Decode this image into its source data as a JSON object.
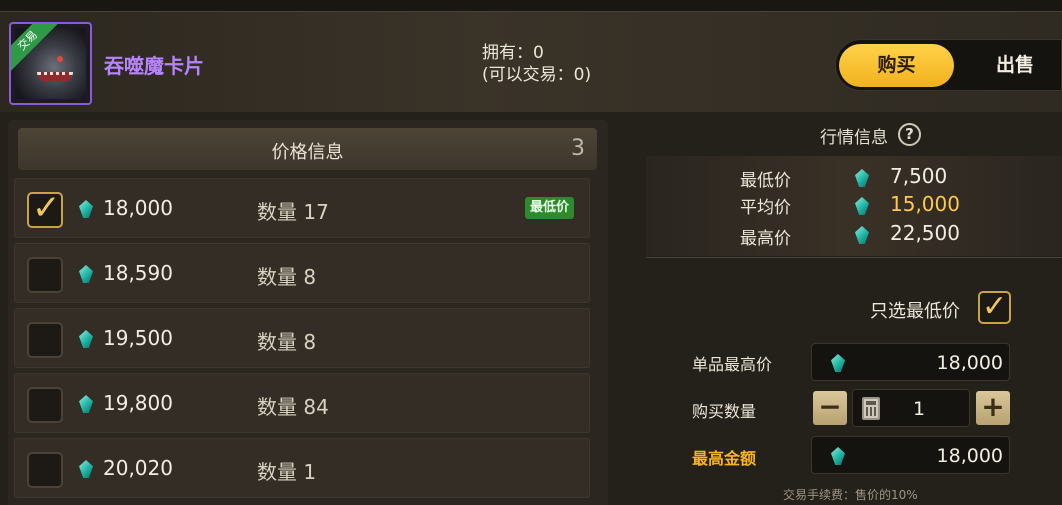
{
  "item": {
    "name": "吞噬魔卡片",
    "trade_ribbon": "交易",
    "owned_line1": "拥有：0",
    "owned_line2": "(可以交易：0)"
  },
  "toggle": {
    "buy_label": "购买",
    "sell_label": "出售"
  },
  "price_panel": {
    "title": "价格信息",
    "count": "3",
    "rows": [
      {
        "price": "18,000",
        "qty": "数量 17",
        "checked": true,
        "badge": "最低价"
      },
      {
        "price": "18,590",
        "qty": "数量 8",
        "checked": false
      },
      {
        "price": "19,500",
        "qty": "数量 8",
        "checked": false
      },
      {
        "price": "19,800",
        "qty": "数量 84",
        "checked": false
      },
      {
        "price": "20,020",
        "qty": "数量 1",
        "checked": false
      }
    ]
  },
  "market": {
    "title": "行情信息",
    "help_symbol": "?",
    "min_label": "最低价",
    "min_value": "7,500",
    "avg_label": "平均价",
    "avg_value": "15,000",
    "max_label": "最高价",
    "max_value": "22,500"
  },
  "purchase": {
    "only_lowest_label": "只选最低价",
    "only_lowest_checked": true,
    "unit_max_label": "单品最高价",
    "unit_max_value": "18,000",
    "quantity_label": "购买数量",
    "quantity_value": "1",
    "minus_symbol": "−",
    "plus_symbol": "+",
    "max_total_label": "最高金额",
    "max_total_value": "18,000",
    "fee_note": "交易手续费：售价的10%"
  },
  "icons": {
    "gem": "crystal-gem-icon",
    "checkmark": "checkmark-icon",
    "calculator": "calculator-icon",
    "help": "help-icon"
  },
  "colors": {
    "accent_buy": "#f2b21d",
    "item_name": "#b784ff",
    "avg_price": "#ffc94a",
    "max_total_label": "#f5b321",
    "lowest_badge": "#2e8a2f"
  }
}
